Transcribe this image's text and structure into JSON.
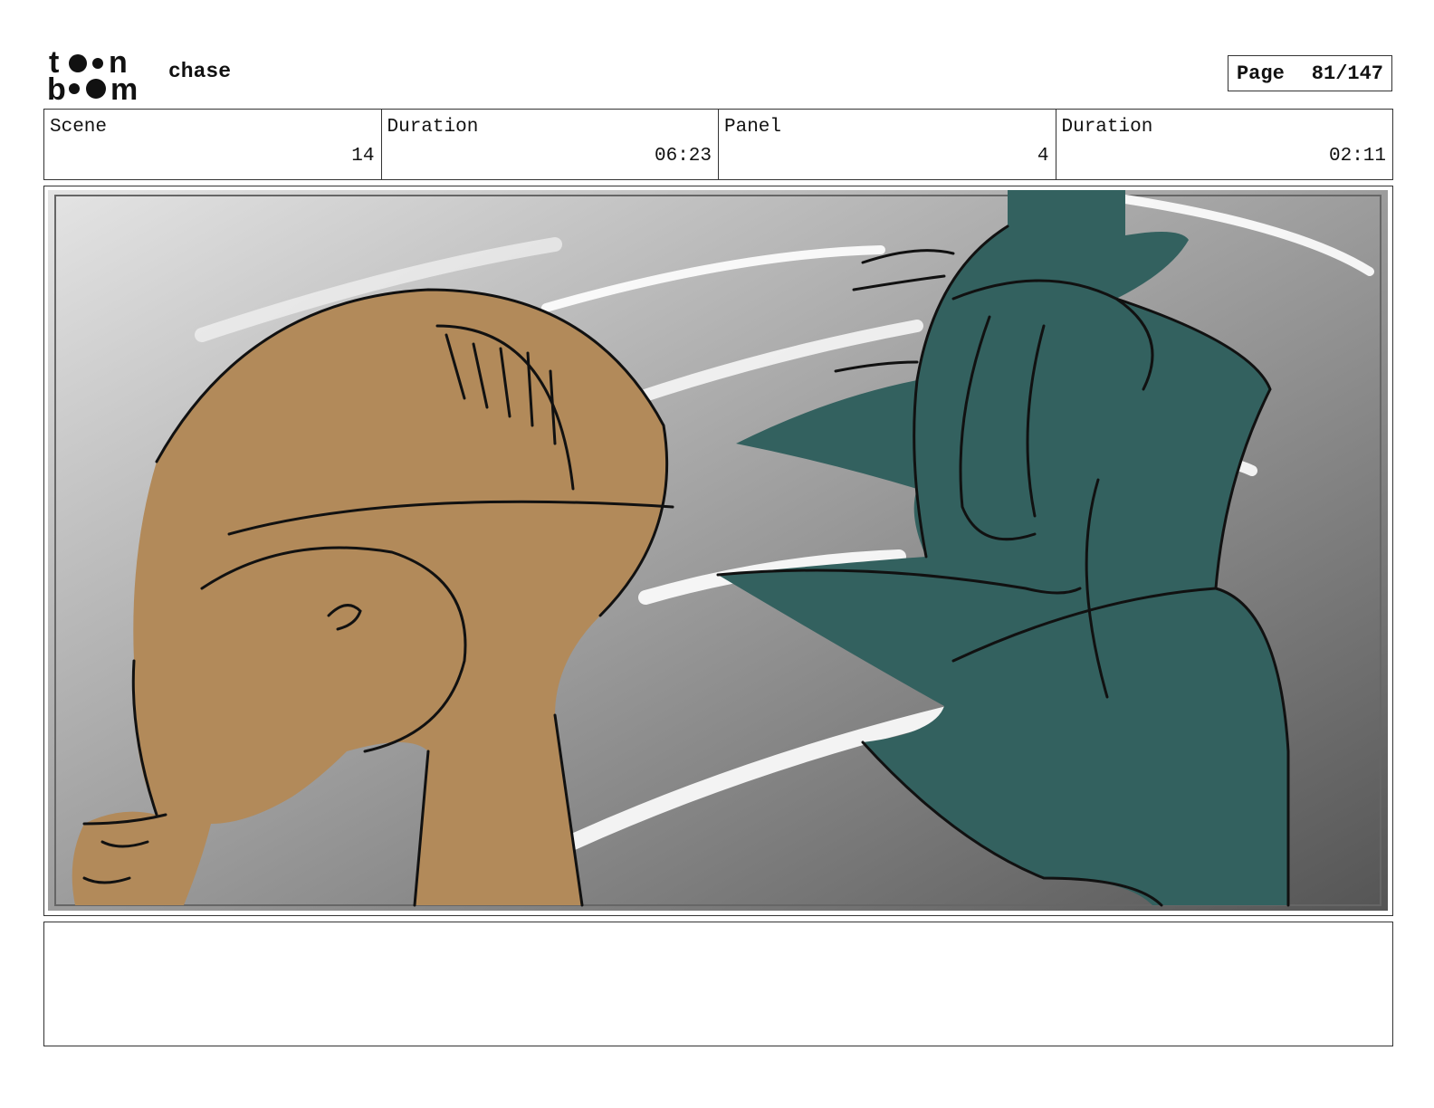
{
  "header": {
    "logo_text": "toon boom",
    "project_title": "chase",
    "page_label": "Page",
    "page_number": "81/147"
  },
  "info": [
    {
      "label": "Scene",
      "value": "14"
    },
    {
      "label": "Duration",
      "value": "06:23"
    },
    {
      "label": "Panel",
      "value": "4"
    },
    {
      "label": "Duration",
      "value": "02:11"
    }
  ],
  "panel": {
    "colors": {
      "bg_light": "#e4e4e4",
      "bg_dark": "#555555",
      "tan_character": "#b28a5a",
      "teal_character": "#33615f",
      "ink": "#111111",
      "speed_lines": "#ffffff"
    }
  },
  "caption": {
    "text": ""
  }
}
